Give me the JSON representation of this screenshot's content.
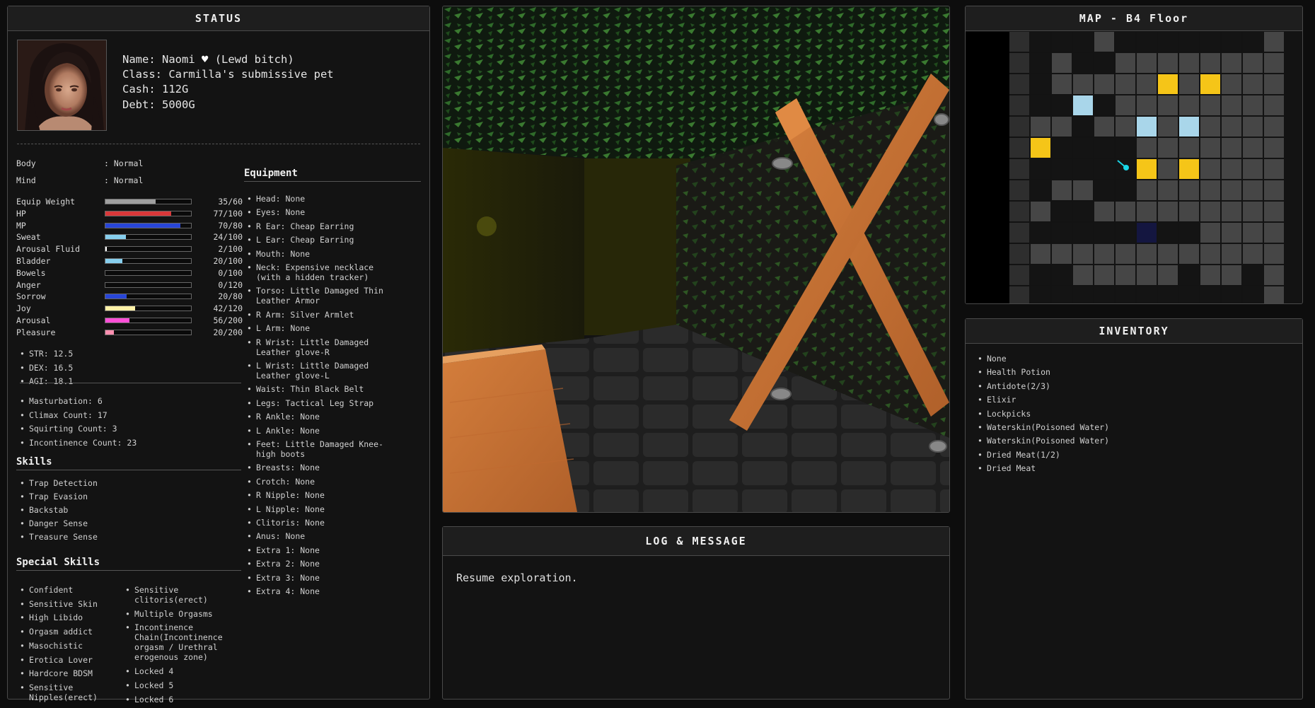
{
  "status": {
    "title": "STATUS",
    "name_label": "Name: Naomi",
    "name_suffix": "(Lewd bitch)",
    "class_label": "Class: Carmilla's submissive pet",
    "cash_label": "Cash: 112G",
    "debt_label": "Debt: 5000G",
    "body_label": "Body",
    "body_value": ": Normal",
    "mind_label": "Mind",
    "mind_value": ": Normal",
    "bars": [
      {
        "label": "Equip Weight",
        "value": "35/60",
        "fraction": 0.583,
        "color": "#a0a0a0"
      },
      {
        "label": "HP",
        "value": "77/100",
        "fraction": 0.77,
        "color": "#d9383a"
      },
      {
        "label": "MP",
        "value": "70/80",
        "fraction": 0.875,
        "color": "#2846d8"
      },
      {
        "label": "Sweat",
        "value": "24/100",
        "fraction": 0.24,
        "color": "#87cfee"
      },
      {
        "label": "Arousal Fluid",
        "value": "2/100",
        "fraction": 0.02,
        "color": "#ffffff"
      },
      {
        "label": "Bladder",
        "value": "20/100",
        "fraction": 0.2,
        "color": "#87cfee"
      },
      {
        "label": "Bowels",
        "value": "0/100",
        "fraction": 0,
        "color": "#8b5a2b"
      },
      {
        "label": "Anger",
        "value": "0/120",
        "fraction": 0,
        "color": "#d03030"
      },
      {
        "label": "Sorrow",
        "value": "20/80",
        "fraction": 0.25,
        "color": "#2846d8"
      },
      {
        "label": "Joy",
        "value": "42/120",
        "fraction": 0.35,
        "color": "#fff2a8"
      },
      {
        "label": "Arousal",
        "value": "56/200",
        "fraction": 0.28,
        "color": "#ff4fd8"
      },
      {
        "label": "Pleasure",
        "value": "20/200",
        "fraction": 0.1,
        "color": "#ff8fb0"
      }
    ],
    "attributes": [
      "STR: 12.5",
      "DEX: 16.5",
      "AGI: 18.1"
    ],
    "counts": [
      "Masturbation: 6",
      "Climax Count: 17",
      "Squirting Count: 3",
      "Incontinence Count: 23"
    ],
    "skills_title": "Skills",
    "skills": [
      "Trap Detection",
      "Trap Evasion",
      "Backstab",
      "Danger Sense",
      "Treasure Sense"
    ],
    "special_skills_title": "Special Skills",
    "special_skills_left": [
      "Confident",
      "Sensitive Skin",
      "High Libido",
      "Orgasm addict",
      "Masochistic",
      "Erotica Lover",
      "Hardcore BDSM",
      "Sensitive\nNipples(erect)"
    ],
    "special_skills_right": [
      "Sensitive\nclitoris(erect)",
      "Multiple Orgasms",
      "Incontinence\nChain(Incontinence\norgasm / Urethral\nerogenous zone)",
      "Locked 4",
      "Locked 5",
      "Locked 6"
    ],
    "equipment_title": "Equipment",
    "equipment": [
      "Head: None",
      "Eyes: None",
      "R Ear: Cheap Earring",
      "L Ear: Cheap Earring",
      "Mouth: None",
      "Neck: Expensive necklace\n(with a hidden tracker)",
      "Torso: Little Damaged Thin\nLeather Armor",
      "R Arm: Silver Armlet",
      "L Arm: None",
      "R Wrist: Little Damaged\nLeather glove-R",
      "L Wrist: Little Damaged\nLeather glove-L",
      "Waist: Thin Black Belt",
      "Legs: Tactical Leg Strap",
      "R Ankle: None",
      "L Ankle: None",
      "Feet: Little Damaged Knee-\nhigh boots",
      "Breasts: None",
      "Crotch: None",
      "R Nipple: None",
      "L Nipple: None",
      "Clitoris: None",
      "Anus: None",
      "Extra 1: None",
      "Extra 2: None",
      "Extra 3: None",
      "Extra 4: None"
    ]
  },
  "log": {
    "title": "LOG & MESSAGE",
    "message": "Resume exploration."
  },
  "map": {
    "title": "MAP - B4 Floor",
    "rows": [
      "DdddLdddddddL",
      "DdLddLLLLLLLL",
      "DdLLLLLYLYLLL",
      "DddCdLLLLLLLL",
      "DLLdLLCLCLLLL",
      "DYddddLLLLLLL",
      "DddddPYLYLLLL",
      "DdLLddLLLLLLL",
      "DLddLLLLLLLLL",
      "DdddddNddLLLL",
      "DLLLLLLLLLLLL",
      "DddLLLLLdLLdL",
      "DdddddddddddL"
    ],
    "colors": {
      "L": "#464646",
      "d": "#141414",
      "D": "#2e2e2e",
      "Y": "#f5c518",
      "C": "#a9d6ea",
      "N": "#141640",
      "P": "#141414"
    },
    "player_marker": "cyan-arrow"
  },
  "inventory": {
    "title": "INVENTORY",
    "items": [
      "None",
      "Health Potion",
      "Antidote(2/3)",
      "Elixir",
      "Lockpicks",
      "Waterskin(Poisoned Water)",
      "Waterskin(Poisoned Water)",
      "Dried Meat(1/2)",
      "Dried Meat"
    ]
  }
}
